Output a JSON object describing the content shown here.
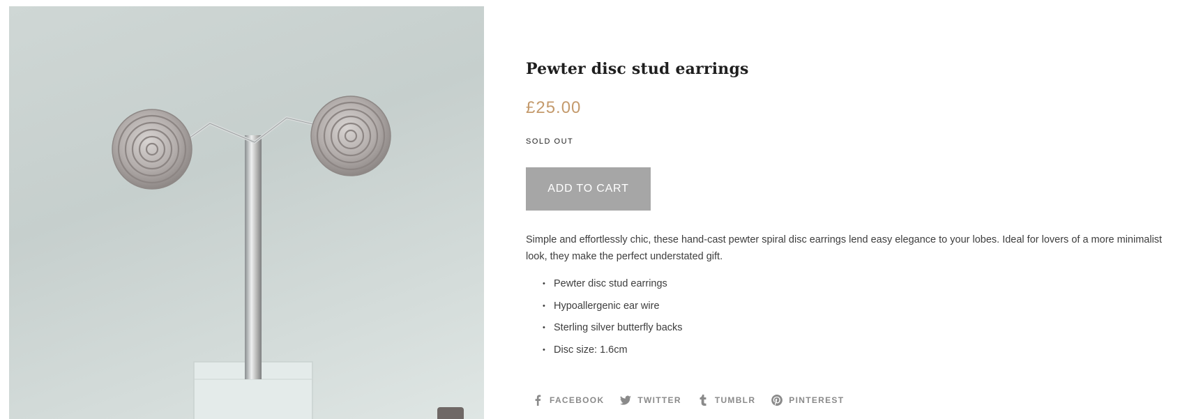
{
  "product": {
    "title": "Pewter disc stud earrings",
    "price": "£25.00",
    "stock_status": "SOLD OUT",
    "add_to_cart_label": "ADD TO CART",
    "description": "Simple and effortlessly chic, these hand-cast pewter spiral disc earrings lend easy elegance to your lobes. Ideal for lovers of a more minimalist look, they make the perfect understated gift.",
    "features": [
      "Pewter disc stud earrings",
      "Hypoallergenic ear wire",
      "Sterling silver butterfly backs",
      "Disc size: 1.6cm"
    ],
    "image_alt": "Pewter spiral disc earrings on a display stand"
  },
  "share": [
    {
      "label": "FACEBOOK",
      "icon": "facebook-icon"
    },
    {
      "label": "TWITTER",
      "icon": "twitter-icon"
    },
    {
      "label": "TUMBLR",
      "icon": "tumblr-icon"
    },
    {
      "label": "PINTEREST",
      "icon": "pinterest-icon"
    }
  ],
  "colors": {
    "price": "#c49a6c",
    "button": "#a6a6a6",
    "text": "#3d3d3d",
    "share": "#8a8a8a"
  }
}
